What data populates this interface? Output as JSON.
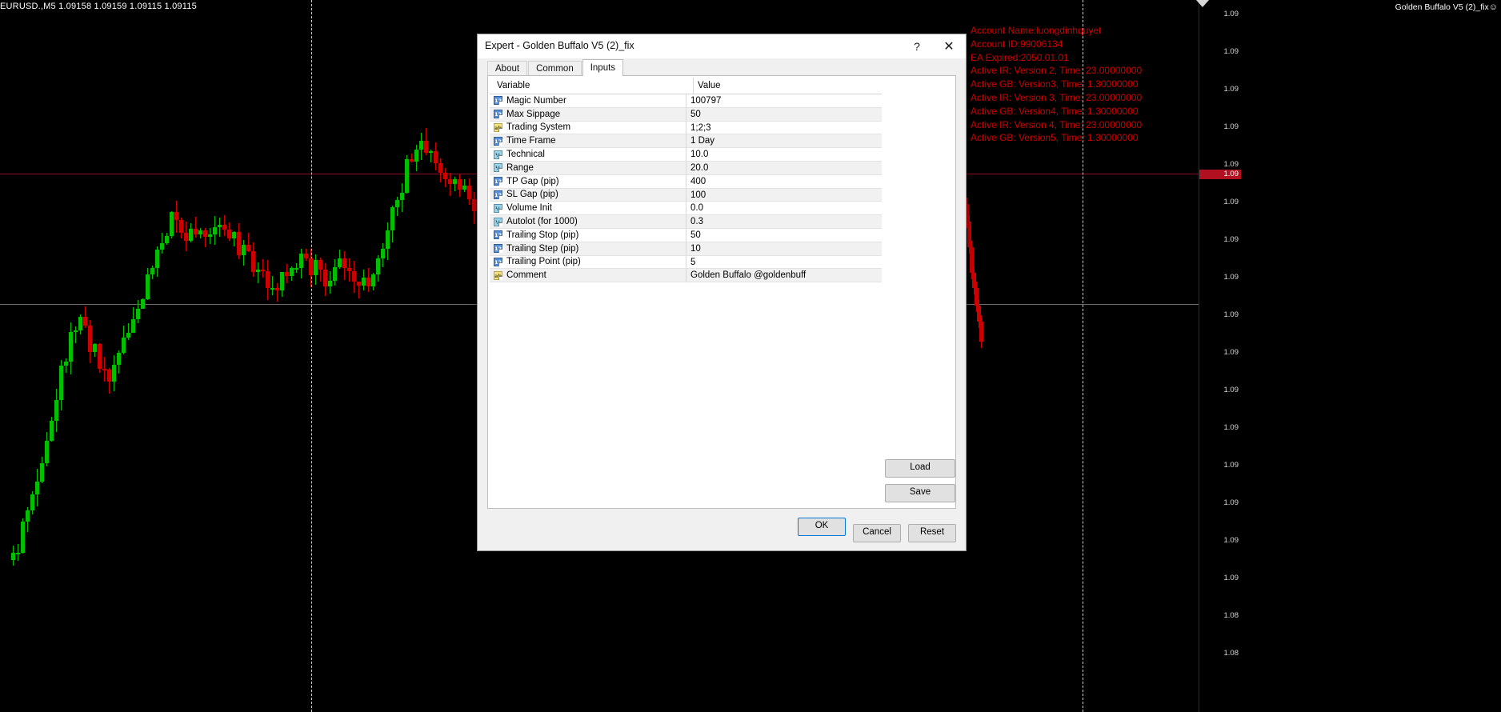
{
  "chart": {
    "symbol_label": "EURUSD.,M5  1.09158 1.09159 1.09115 1.09115",
    "ea_label": "Golden Buffalo V5 (2)_fix",
    "ea_smiley": "☺",
    "current_price": "1.09",
    "price_ticks": [
      "1.09",
      "1.09",
      "1.09",
      "1.09",
      "1.09",
      "1.09",
      "1.09",
      "1.09",
      "1.09",
      "1.09",
      "1.09",
      "1.09",
      "1.09",
      "1.09",
      "1.09",
      "1.09",
      "1.08",
      "1.08"
    ],
    "overlay_lines": [
      "Account Name:luongdinhquyet",
      "Account ID:99006134",
      "EA Expired:2050.01.01",
      "Active IR: Version  2, Time: 23.00000000",
      "Active GB: Version3, Time: 1.30000000",
      "Active IR: Version  3, Time: 23.00000000",
      "Active GB: Version4, Time: 1.30000000",
      "Active IR: Version  4, Time: 23.00000000",
      "Active GB: Version5, Time: 1.30000000"
    ],
    "overlay_color": "#cc0000"
  },
  "dialog": {
    "title": "Expert - Golden Buffalo V5 (2)_fix",
    "help_icon": "?",
    "close_icon": "✕",
    "tabs": [
      {
        "label": "About",
        "active": false
      },
      {
        "label": "Common",
        "active": false
      },
      {
        "label": "Inputs",
        "active": true
      }
    ],
    "columns": {
      "variable": "Variable",
      "value": "Value"
    },
    "rows": [
      {
        "icon": "int",
        "icon_text": "123",
        "variable": "Magic Number",
        "value": "100797"
      },
      {
        "icon": "int",
        "icon_text": "123",
        "variable": "Max Sippage",
        "value": "50"
      },
      {
        "icon": "str",
        "icon_text": "ab",
        "variable": "Trading System",
        "value": "1;2;3"
      },
      {
        "icon": "int",
        "icon_text": "123",
        "variable": "Time Frame",
        "value": "1 Day"
      },
      {
        "icon": "dbl",
        "icon_text": "½",
        "variable": "Technical",
        "value": "10.0"
      },
      {
        "icon": "dbl",
        "icon_text": "½",
        "variable": "Range",
        "value": "20.0"
      },
      {
        "icon": "int",
        "icon_text": "123",
        "variable": "TP Gap (pip)",
        "value": "400"
      },
      {
        "icon": "int",
        "icon_text": "123",
        "variable": "SL Gap (pip)",
        "value": "100"
      },
      {
        "icon": "dbl",
        "icon_text": "½",
        "variable": "Volume Init",
        "value": "0.0"
      },
      {
        "icon": "dbl",
        "icon_text": "½",
        "variable": "Autolot (for 1000)",
        "value": "0.3"
      },
      {
        "icon": "int",
        "icon_text": "123",
        "variable": "Trailing Stop (pip)",
        "value": "50"
      },
      {
        "icon": "int",
        "icon_text": "123",
        "variable": "Trailing Step (pip)",
        "value": "10"
      },
      {
        "icon": "int",
        "icon_text": "123",
        "variable": "Trailing Point (pip)",
        "value": "5"
      },
      {
        "icon": "str",
        "icon_text": "ab",
        "variable": "Comment",
        "value": "Golden Buffalo @goldenbuff"
      }
    ],
    "side_buttons": {
      "load": "Load",
      "save": "Save"
    },
    "footer_buttons": {
      "ok": "OK",
      "cancel": "Cancel",
      "reset": "Reset"
    }
  }
}
